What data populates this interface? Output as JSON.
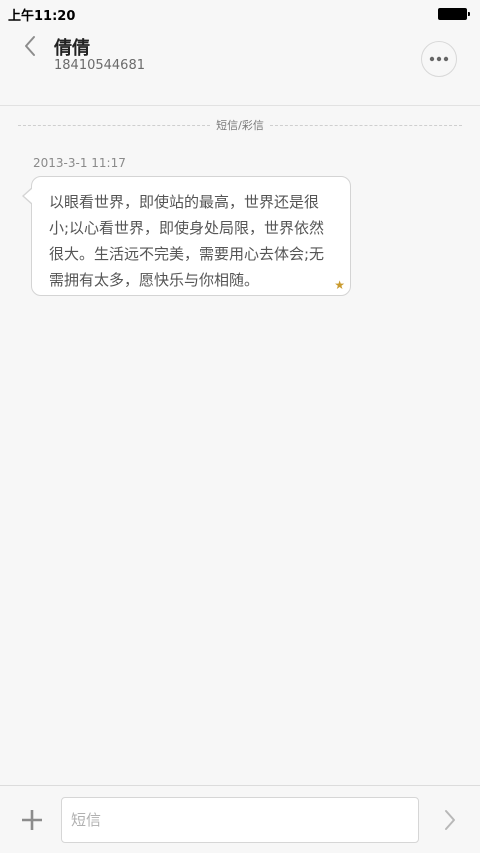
{
  "status_bar": {
    "time": "上午11:20",
    "battery_icon": "battery-full-icon"
  },
  "header": {
    "back_icon": "chevron-left-icon",
    "contact_name": "倩倩",
    "contact_number": "18410544681",
    "more_icon": "more-dots-icon"
  },
  "conversation": {
    "divider_label": "短信/彩信",
    "messages": [
      {
        "timestamp": "2013-3-1 11:17",
        "text": "以眼看世界，即使站的最高，世界还是很小;以心看世界，即使身处局限，世界依然很大。生活远不完美，需要用心去体会;无需拥有太多，愿快乐与你相随。",
        "starred": true,
        "star_icon": "star-icon"
      }
    ]
  },
  "input_bar": {
    "add_icon": "plus-icon",
    "placeholder": "短信",
    "value": "",
    "send_icon": "chevron-right-icon"
  },
  "colors": {
    "background": "#f7f7f7",
    "bubble": "#ffffff",
    "star": "#c99a2e",
    "icon_gray": "#8c8c8c"
  }
}
